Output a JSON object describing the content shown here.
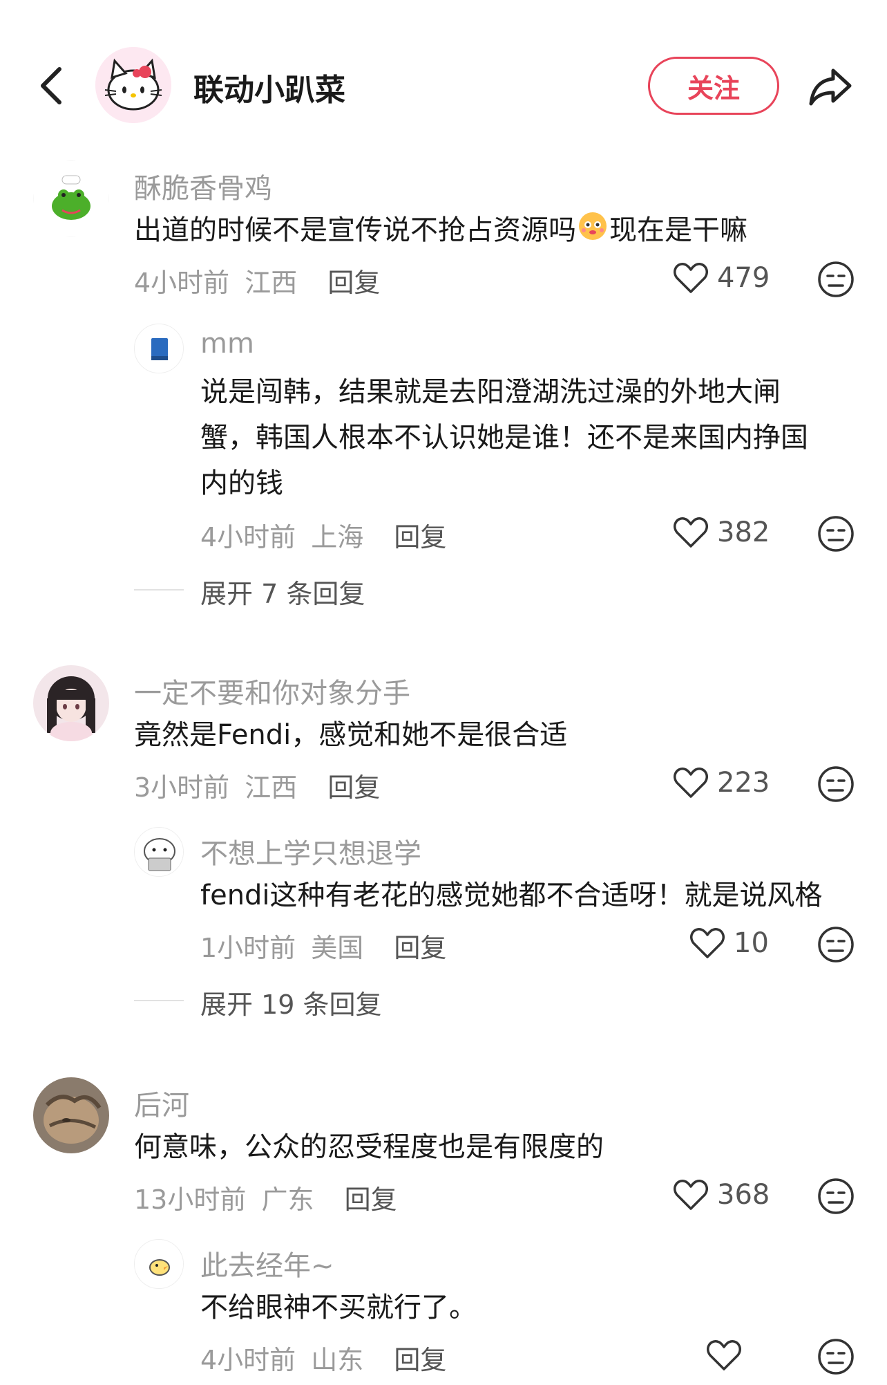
{
  "header": {
    "title": "联动小趴菜",
    "follow_label": "关注"
  },
  "comments": [
    {
      "user": "酥脆香骨鸡",
      "text": "出道的时候不是宣传说不抢占资源吗",
      "text_after": "现在是干嘛",
      "time": "4小时前",
      "location": "江西",
      "reply_label": "回复",
      "likes": "479",
      "replies": [
        {
          "user": "mm",
          "text_line1": "说是闯韩，结果就是去阳澄湖洗过澡的外地大闸",
          "text_line2": "蟹，韩国人根本不认识她是谁！还不是来国内挣国",
          "text_line3": "内的钱",
          "time": "4小时前",
          "location": "上海",
          "reply_label": "回复",
          "likes": "382"
        }
      ],
      "expand_label": "展开 7 条回复"
    },
    {
      "user": "一定不要和你对象分手",
      "text": "竟然是Fendi，感觉和她不是很合适",
      "time": "3小时前",
      "location": "江西",
      "reply_label": "回复",
      "likes": "223",
      "replies": [
        {
          "user": "不想上学只想退学",
          "text_line1": "fendi这种有老花的感觉她都不合适呀！就是说风格",
          "time": "1小时前",
          "location": "美国",
          "reply_label": "回复",
          "likes": "10"
        }
      ],
      "expand_label": "展开 19 条回复"
    },
    {
      "user": "后河",
      "text": "何意味，公众的忍受程度也是有限度的",
      "time": "13小时前",
      "location": "广东",
      "reply_label": "回复",
      "likes": "368",
      "replies": [
        {
          "user": "此去经年~",
          "text_line1": "不给眼神不买就行了。",
          "time": "4小时前",
          "location": "山东",
          "reply_label": "回复"
        }
      ]
    }
  ],
  "colors": {
    "accent": "#e8445a",
    "muted": "#9a9a9a",
    "text": "#1a1a1a"
  }
}
